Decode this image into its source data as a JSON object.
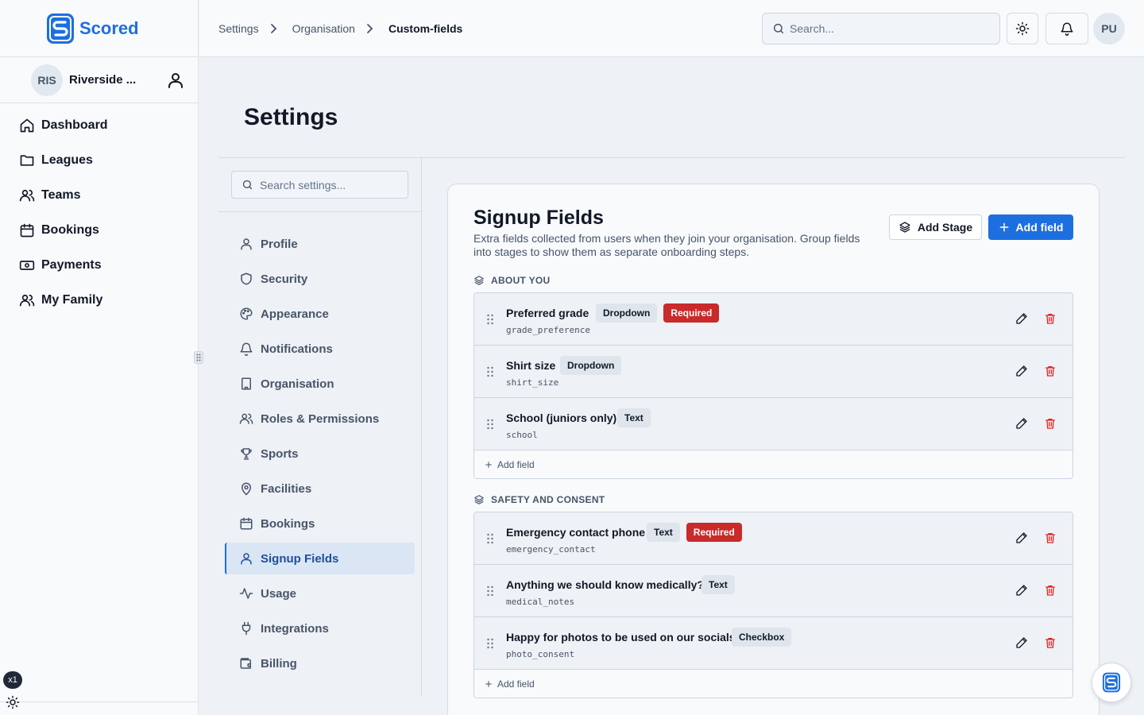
{
  "brand": {
    "name": "Scored",
    "logo_icon": "scored-logo-icon",
    "accent": "#1d6fe0"
  },
  "org": {
    "initials": "RIS",
    "name": "Riverside ..."
  },
  "main_nav": [
    {
      "label": "Dashboard",
      "icon": "home-icon"
    },
    {
      "label": "Leagues",
      "icon": "folder-icon"
    },
    {
      "label": "Teams",
      "icon": "users-icon"
    },
    {
      "label": "Bookings",
      "icon": "calendar-icon"
    },
    {
      "label": "Payments",
      "icon": "banknote-icon"
    },
    {
      "label": "My Family",
      "icon": "users-icon"
    }
  ],
  "speed_badge": "x1",
  "breadcrumbs": [
    "Settings",
    "Organisation",
    "Custom-fields"
  ],
  "search": {
    "placeholder": "Search..."
  },
  "user": {
    "initials": "PU"
  },
  "page_title": "Settings",
  "settings_search": {
    "placeholder": "Search settings..."
  },
  "settings_nav": [
    {
      "label": "Profile",
      "icon": "user-icon"
    },
    {
      "label": "Security",
      "icon": "shield-icon"
    },
    {
      "label": "Appearance",
      "icon": "palette-icon"
    },
    {
      "label": "Notifications",
      "icon": "bell-icon"
    },
    {
      "label": "Organisation",
      "icon": "building-icon"
    },
    {
      "label": "Roles & Permissions",
      "icon": "users-icon"
    },
    {
      "label": "Sports",
      "icon": "trophy-icon"
    },
    {
      "label": "Facilities",
      "icon": "map-pin-icon"
    },
    {
      "label": "Bookings",
      "icon": "calendar-icon"
    },
    {
      "label": "Signup Fields",
      "icon": "user-icon",
      "active": true
    },
    {
      "label": "Usage",
      "icon": "activity-icon"
    },
    {
      "label": "Integrations",
      "icon": "plug-icon"
    },
    {
      "label": "Billing",
      "icon": "wallet-icon"
    }
  ],
  "signup": {
    "title": "Signup Fields",
    "description": "Extra fields collected from users when they join your organisation. Group fields into stages to show them as separate onboarding steps.",
    "add_stage_label": "Add Stage",
    "add_field_label": "Add field",
    "stages": [
      {
        "name": "ABOUT YOU",
        "add_label": "Add field",
        "fields": [
          {
            "label": "Preferred grade",
            "key": "grade_preference",
            "type": "Dropdown",
            "required": "Required"
          },
          {
            "label": "Shirt size",
            "key": "shirt_size",
            "type": "Dropdown",
            "required": ""
          },
          {
            "label": "School (juniors only)",
            "key": "school",
            "type": "Text",
            "required": ""
          }
        ]
      },
      {
        "name": "SAFETY AND CONSENT",
        "add_label": "Add field",
        "fields": [
          {
            "label": "Emergency contact phone",
            "key": "emergency_contact",
            "type": "Text",
            "required": "Required"
          },
          {
            "label": "Anything we should know medically?",
            "key": "medical_notes",
            "type": "Text",
            "required": ""
          },
          {
            "label": "Happy for photos to be used on our socials",
            "key": "photo_consent",
            "type": "Checkbox",
            "required": ""
          }
        ]
      }
    ]
  },
  "colors": {
    "required": "#c92a2a",
    "delete": "#dc2626",
    "active_nav_bg": "#dbe6f5"
  }
}
